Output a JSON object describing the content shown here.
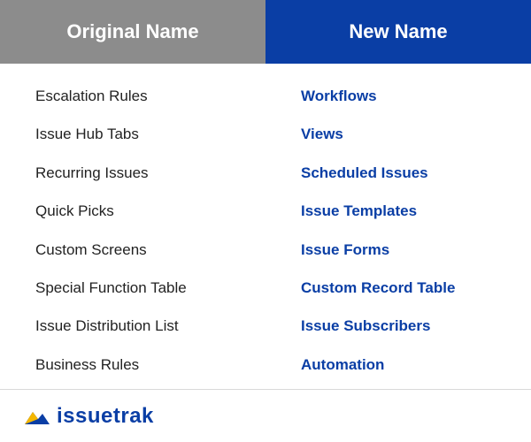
{
  "header": {
    "original": "Original Name",
    "new": "New Name"
  },
  "rows": [
    {
      "original": "Escalation Rules",
      "new": "Workflows"
    },
    {
      "original": "Issue Hub Tabs",
      "new": "Views"
    },
    {
      "original": "Recurring Issues",
      "new": "Scheduled Issues"
    },
    {
      "original": "Quick Picks",
      "new": "Issue Templates"
    },
    {
      "original": "Custom Screens",
      "new": "Issue Forms"
    },
    {
      "original": "Special Function Table",
      "new": "Custom Record Table"
    },
    {
      "original": "Issue Distribution List",
      "new": "Issue Subscribers"
    },
    {
      "original": "Business Rules",
      "new": "Automation"
    }
  ],
  "footer": {
    "brand": "issuetrak"
  },
  "colors": {
    "header_left_bg": "#8c8c8c",
    "header_right_bg": "#0a3ea5",
    "new_name_color": "#0a3ea5"
  }
}
